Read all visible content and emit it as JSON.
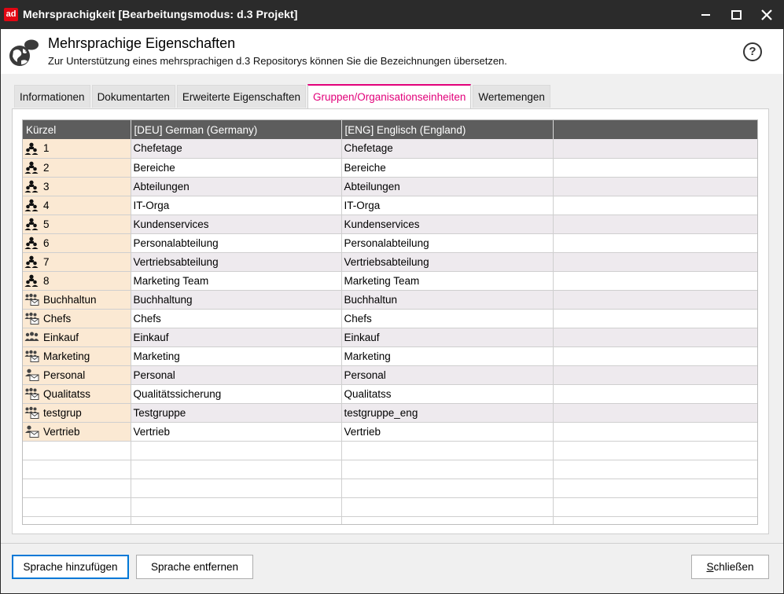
{
  "window": {
    "logo": "ad",
    "title": "Mehrsprachigkeit  [Bearbeitungsmodus: d.3 Projekt]"
  },
  "header": {
    "title": "Mehrsprachige Eigenschaften",
    "subtitle": "Zur Unterstützung eines mehrsprachigen d.3 Repositorys können Sie die Bezeichnungen übersetzen.",
    "help": "?"
  },
  "tabs": [
    {
      "label": "Informationen",
      "active": false
    },
    {
      "label": "Dokumentarten",
      "active": false
    },
    {
      "label": "Erweiterte Eigenschaften",
      "active": false
    },
    {
      "label": "Gruppen/Organisationseinheiten",
      "active": true
    },
    {
      "label": "Wertemengen",
      "active": false
    }
  ],
  "grid": {
    "columns": [
      "Kürzel",
      "[DEU] German (Germany)",
      "[ENG] Englisch (England)",
      ""
    ],
    "rows": [
      {
        "icon": "org-unit-icon",
        "key": "1",
        "deu": "Chefetage",
        "eng": "Chefetage"
      },
      {
        "icon": "org-unit-icon",
        "key": "2",
        "deu": "Bereiche",
        "eng": "Bereiche"
      },
      {
        "icon": "org-unit-icon",
        "key": "3",
        "deu": "Abteilungen",
        "eng": "Abteilungen"
      },
      {
        "icon": "org-unit-icon",
        "key": "4",
        "deu": "IT-Orga",
        "eng": "IT-Orga"
      },
      {
        "icon": "org-unit-icon",
        "key": "5",
        "deu": "Kundenservices",
        "eng": "Kundenservices"
      },
      {
        "icon": "org-unit-icon",
        "key": "6",
        "deu": "Personalabteilung",
        "eng": "Personalabteilung"
      },
      {
        "icon": "org-unit-icon",
        "key": "7",
        "deu": "Vertriebsabteilung",
        "eng": "Vertriebsabteilung"
      },
      {
        "icon": "org-unit-icon",
        "key": "8",
        "deu": "Marketing Team",
        "eng": "Marketing Team"
      },
      {
        "icon": "mail-group-icon",
        "key": "Buchhaltun",
        "deu": "Buchhaltung",
        "eng": "Buchhaltun"
      },
      {
        "icon": "mail-group-icon",
        "key": "Chefs",
        "deu": "Chefs",
        "eng": "Chefs"
      },
      {
        "icon": "group-icon",
        "key": "Einkauf",
        "deu": "Einkauf",
        "eng": "Einkauf"
      },
      {
        "icon": "mail-group-icon",
        "key": "Marketing",
        "deu": "Marketing",
        "eng": "Marketing"
      },
      {
        "icon": "mail-user-icon",
        "key": "Personal",
        "deu": "Personal",
        "eng": "Personal"
      },
      {
        "icon": "mail-group-icon",
        "key": "Qualitatss",
        "deu": "Qualitätssicherung",
        "eng": "Qualitatss"
      },
      {
        "icon": "mail-group-icon",
        "key": "testgrup",
        "deu": "Testgruppe",
        "eng": "testgruppe_eng"
      },
      {
        "icon": "mail-user-icon",
        "key": "Vertrieb",
        "deu": "Vertrieb",
        "eng": "Vertrieb"
      }
    ],
    "empty_rows": 5
  },
  "footer": {
    "add_language": "Sprache hinzufügen",
    "remove_language": "Sprache entfernen",
    "close_first": "S",
    "close_rest": "chließen"
  },
  "colors": {
    "titlebar": "#2b2b2b",
    "brand": "#e20613",
    "active_tab": "#e2007a",
    "grid_header": "#5d5d5d",
    "key_cell": "#fbe9d3",
    "alt_row": "#eeeaee",
    "primary_button_border": "#0078d7"
  }
}
